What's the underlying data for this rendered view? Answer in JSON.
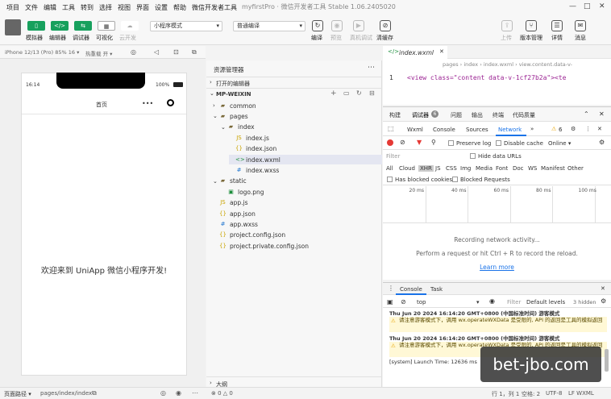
{
  "menubar": {
    "items": [
      "项目",
      "文件",
      "编辑",
      "工具",
      "转到",
      "选择",
      "视图",
      "界面",
      "设置",
      "帮助",
      "微信开发者工具"
    ],
    "window_title": "myfirstPro · 微信开发者工具 Stable 1.06.2405020",
    "controls": [
      "—",
      "□",
      "✕"
    ]
  },
  "toolbar": {
    "buttons": [
      {
        "label": "模拟器",
        "icon": "▯"
      },
      {
        "label": "编辑器",
        "icon": "</>"
      },
      {
        "label": "调试器",
        "icon": "⇆"
      },
      {
        "label": "可视化",
        "icon": "▦"
      },
      {
        "label": "云开发",
        "icon": "☁"
      }
    ],
    "mode_select": "小程序模式",
    "compile_select": "普通编译",
    "actions": [
      {
        "label": "编译",
        "icon": "↻"
      },
      {
        "label": "预览",
        "icon": "◉"
      },
      {
        "label": "真机调试",
        "icon": "▶"
      },
      {
        "label": "清缓存",
        "icon": "⊘"
      }
    ],
    "right_actions": [
      {
        "label": "上传",
        "icon": "⇪"
      },
      {
        "label": "版本管理",
        "icon": "⑂"
      },
      {
        "label": "详情",
        "icon": "☰"
      },
      {
        "label": "消息",
        "icon": "✉"
      }
    ]
  },
  "simulator": {
    "device": "iPhone 12/13 (Pro) 85% 16 ▾",
    "hotreload": "热重载 开 ▾",
    "status_time": "16:14",
    "battery": "100%",
    "nav_title": "首页",
    "message": "欢迎来到 UniApp 微信小程序开发!"
  },
  "explorer": {
    "title": "资源管理器",
    "open_editors": "打开的编辑器",
    "project": "MP-WEIXIN",
    "tree": [
      {
        "label": "common",
        "type": "folder",
        "depth": 0,
        "arrow": "›"
      },
      {
        "label": "pages",
        "type": "folder",
        "depth": 0,
        "arrow": "⌄"
      },
      {
        "label": "index",
        "type": "folder",
        "depth": 1,
        "arrow": "⌄"
      },
      {
        "label": "index.js",
        "type": "js",
        "depth": 2
      },
      {
        "label": "index.json",
        "type": "json",
        "depth": 2
      },
      {
        "label": "index.wxml",
        "type": "wxml",
        "depth": 2
      },
      {
        "label": "index.wxss",
        "type": "wxss",
        "depth": 2
      },
      {
        "label": "static",
        "type": "folder",
        "depth": 0,
        "arrow": "⌄"
      },
      {
        "label": "logo.png",
        "type": "png",
        "depth": 1
      },
      {
        "label": "app.js",
        "type": "js",
        "depth": 0
      },
      {
        "label": "app.json",
        "type": "json",
        "depth": 0
      },
      {
        "label": "app.wxss",
        "type": "wxss",
        "depth": 0
      },
      {
        "label": "project.config.json",
        "type": "json",
        "depth": 0
      },
      {
        "label": "project.private.config.json",
        "type": "json",
        "depth": 0
      }
    ],
    "outline": "大纲"
  },
  "editor": {
    "tab": "index.wxml",
    "breadcrumb": "pages › index › index.wxml › view.content.data-v-",
    "line_no": "1",
    "code": "<view class=\"content data-v-1cf27b2a\"><te"
  },
  "devtools": {
    "panel_tabs": [
      "构建",
      "调试器",
      "问题",
      "输出",
      "终端",
      "代码质量"
    ],
    "debugger_badge": "6",
    "tabs": [
      "Wxml",
      "Console",
      "Sources",
      "Network"
    ],
    "warn_count": "6",
    "throttle": "Online",
    "preserve_log": "Preserve log",
    "disable_cache": "Disable cache",
    "filter_placeholder": "Filter",
    "hide_data_urls": "Hide data URLs",
    "types": [
      "All",
      "Cloud",
      "XHR",
      "JS",
      "CSS",
      "Img",
      "Media",
      "Font",
      "Doc",
      "WS",
      "Manifest",
      "Other"
    ],
    "has_blocked": "Has blocked cookies",
    "blocked_requests": "Blocked Requests",
    "timeline": [
      "20 ms",
      "40 ms",
      "60 ms",
      "80 ms",
      "100 ms"
    ],
    "recording": "Recording network activity...",
    "hint": "Perform a request or hit Ctrl + R to record the reload.",
    "learn_more": "Learn more"
  },
  "console": {
    "tabs": [
      "Console",
      "Task"
    ],
    "context": "top",
    "filter": "Filter",
    "levels": "Default levels",
    "hidden": "3 hidden",
    "lines": [
      {
        "text": "Thu Jun 20 2024 16:14:20 GMT+0800 (中国标准时间) 游客模式",
        "kind": "header"
      },
      {
        "text": "请注意游客模式下，调用 wx.operateWXData 是受限的, API 的返回是工具的模拟返回",
        "kind": "warn"
      },
      {
        "text": "Thu Jun 20 2024 16:14:20 GMT+0800 (中国标准时间) 游客模式",
        "kind": "header"
      },
      {
        "text": "请注意游客模式下，调用 wx.operateWXData 是受限的, API 的返回是工具的模拟返回",
        "kind": "warn"
      },
      {
        "text": "[system] Launch Time: 12636 ms",
        "kind": "system"
      }
    ]
  },
  "statusbar": {
    "path_label": "页面路径 ▾",
    "path": "pages/index/index",
    "errors": "⊗ 0 △ 0",
    "position": "行 1，列 1",
    "spaces": "空格: 2",
    "encoding": "UTF-8",
    "lang": "LF  WXML"
  },
  "watermark": "bet-jbo.com"
}
